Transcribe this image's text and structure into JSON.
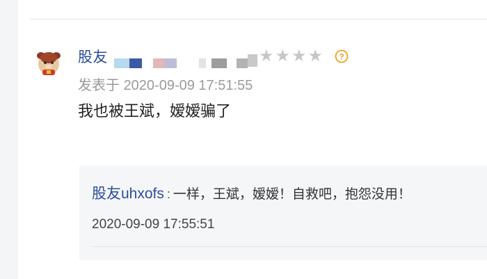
{
  "comment": {
    "username": "股友",
    "rating": {
      "filled": 0,
      "total": 5
    },
    "meta_prefix": "发表于",
    "timestamp": "2020-09-09 17:51:55",
    "content": "我也被王斌，嫒嫒骗了"
  },
  "reply": {
    "username": "股友uhxofs",
    "separator": ":",
    "text": "一样，王斌，嫒嫒！自救吧，抱怨没用！",
    "timestamp": "2020-09-09 17:55:51"
  },
  "colors": {
    "username": "#2b4d9b",
    "star_empty": "#c7c7c7",
    "help_icon": "#f0a020",
    "meta_text": "#9a9a9a",
    "reply_bg": "#f5f6f7"
  },
  "icons": {
    "avatar": "avatar-icon",
    "help": "question-help-icon",
    "star": "star-icon"
  }
}
